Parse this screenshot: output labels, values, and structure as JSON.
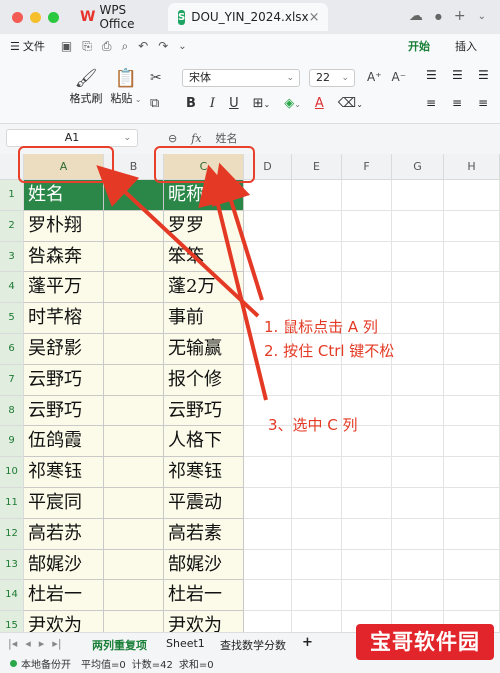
{
  "titlebar": {
    "app_tab": "WPS Office",
    "file_tab": "DOU_YIN_2024.xlsx"
  },
  "menu": {
    "file": "文件",
    "start": "开始",
    "insert": "插入"
  },
  "ribbon": {
    "format_painter": "格式刷",
    "paste": "粘贴",
    "font_name": "宋体",
    "font_size": "22",
    "bold": "B",
    "italic": "I",
    "underline": "U",
    "grow_font": "A⁺",
    "shrink_font": "A⁻",
    "font_color": "A"
  },
  "formula": {
    "name_box": "A1",
    "fx": "fx",
    "content": "姓名"
  },
  "grid": {
    "columns": [
      "A",
      "B",
      "C",
      "D",
      "E",
      "F",
      "G",
      "H"
    ],
    "rows": [
      "1",
      "2",
      "3",
      "4",
      "5",
      "6",
      "7",
      "8",
      "9",
      "10",
      "11",
      "12",
      "13",
      "14",
      "15"
    ],
    "col_a": [
      "姓名",
      "罗朴翔",
      "咎森奔",
      "蓬平万",
      "时芊榕",
      "吴舒影",
      "云野巧",
      "云野巧",
      "伍鸽霞",
      "祁寒钰",
      "平宸同",
      "高若苏",
      "郜娓沙",
      "杜岩一",
      "尹欢为"
    ],
    "col_c": [
      "昵称",
      "罗罗",
      "笨笨",
      "蓬2万",
      "事前",
      "无输赢",
      "报个修",
      "云野巧",
      "人格下",
      "祁寒钰",
      "平震动",
      "高若素",
      "郜娓沙",
      "杜岩一",
      "尹欢为"
    ]
  },
  "annotations": {
    "step1": "1. 鼠标点击 A 列",
    "step2": "2. 按住 Ctrl 键不松",
    "step3": "3、选中 C 列"
  },
  "sheets": {
    "tabs": [
      "两列重复项",
      "Sheet1",
      "查找数学分数"
    ],
    "add": "+"
  },
  "status": {
    "backup": "本地备份开",
    "average": "平均值=0",
    "count": "计数=42",
    "sum": "求和=0"
  },
  "watermark": "宝哥软件园",
  "colors": {
    "accent": "#1a7f37",
    "header_fill": "#2a8748",
    "annotation": "#e43a25"
  }
}
